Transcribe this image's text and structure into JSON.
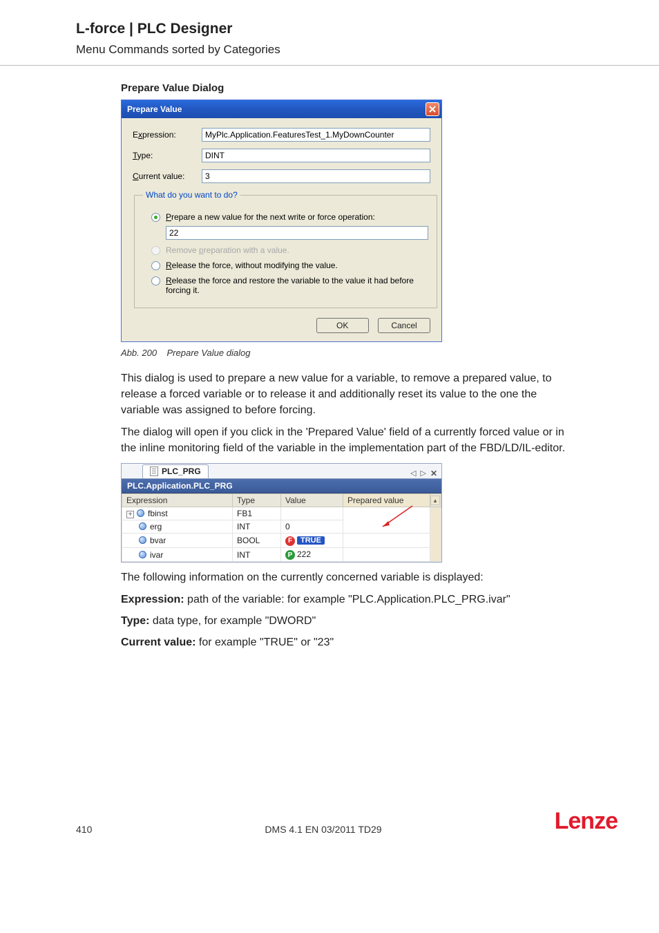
{
  "header": {
    "title": "L-force | PLC Designer",
    "subtitle": "Menu Commands sorted by Categories"
  },
  "section_heading": "Prepare Value Dialog",
  "dialog": {
    "title": "Prepare Value",
    "labels": {
      "expression_pre": "E",
      "expression_u": "x",
      "expression_post": "pression:",
      "type_u": "T",
      "type_post": "ype:",
      "current_u": "C",
      "current_post": "urrent value:"
    },
    "expression": "MyPlc.Application.FeaturesTest_1.MyDownCounter",
    "type": "DINT",
    "current": "3",
    "group_legend": "What do you want to do?",
    "opt1_u": "P",
    "opt1_post": "repare a new value for the next write or force operation:",
    "opt1_value": "22",
    "opt2_pre": "Remove ",
    "opt2_u": "p",
    "opt2_post": "reparation with a value.",
    "opt3_u": "R",
    "opt3_post": "elease the force, without modifying the value.",
    "opt4_u": "R",
    "opt4_post": "elease the force and restore the variable to the value it had before forcing it.",
    "ok": "OK",
    "cancel": "Cancel"
  },
  "caption": {
    "num": "Abb. 200",
    "text": "Prepare Value dialog"
  },
  "para1": "This dialog is used to prepare a new value for a variable, to remove a prepared value, to release a forced variable or to release it and additionally reset its value to the one the variable was assigned to before forcing.",
  "para2": "The dialog will open if you click in the 'Prepared Value' field of a currently forced value or in the inline monitoring field of the variable in the implementation part of the FBD/LD/IL-editor.",
  "watch": {
    "tab": "PLC_PRG",
    "appbar": "PLC.Application.PLC_PRG",
    "cols": {
      "expr": "Expression",
      "type": "Type",
      "value": "Value",
      "prep": "Prepared value"
    },
    "rows": [
      {
        "name": "fbinst",
        "type": "FB1",
        "value": "",
        "badge": "",
        "expand": true
      },
      {
        "name": "erg",
        "type": "INT",
        "value": "0",
        "badge": ""
      },
      {
        "name": "bvar",
        "type": "BOOL",
        "value": "TRUE",
        "badge": "F"
      },
      {
        "name": "ivar",
        "type": "INT",
        "value": "222",
        "badge": "P"
      }
    ]
  },
  "post1": "The following information on the currently concerned variable is displayed:",
  "post2_b": "Expression:",
  "post2": " path of the variable: for example \"PLC.Application.PLC_PRG.ivar\"",
  "post3_b": "Type:",
  "post3": " data type, for example \"DWORD\"",
  "post4_b": "Current value:",
  "post4": " for example \"TRUE\" or \"23\"",
  "footer": {
    "page": "410",
    "doc": "DMS 4.1 EN 03/2011 TD29",
    "brand": "Lenze"
  }
}
